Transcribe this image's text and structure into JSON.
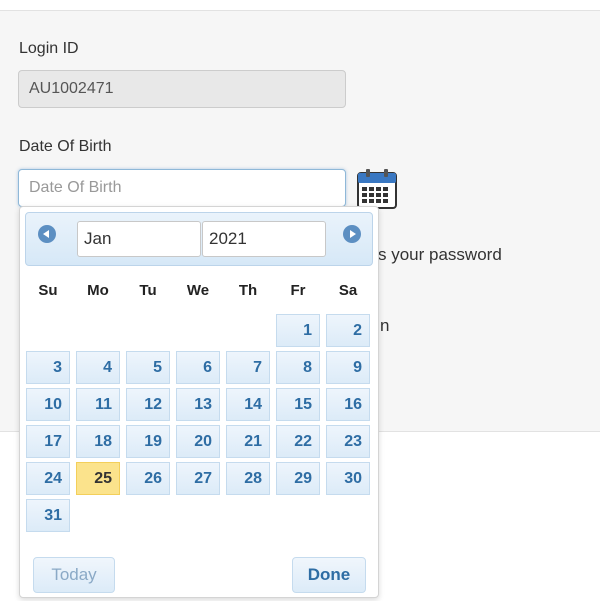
{
  "form": {
    "login_label": "Login ID",
    "login_value": "AU1002471",
    "dob_label": "Date Of Birth",
    "dob_placeholder": "Date Of Birth",
    "dob_value": "",
    "behind_text_1": "s your password",
    "behind_text_2": "n"
  },
  "datepicker": {
    "month": "Jan",
    "year": "2021",
    "weekdays": [
      "Su",
      "Mo",
      "Tu",
      "We",
      "Th",
      "Fr",
      "Sa"
    ],
    "first_weekday_index": 5,
    "days_in_month": 31,
    "highlighted_day": 25,
    "today_label": "Today",
    "done_label": "Done"
  },
  "icons": {
    "calendar": "calendar-icon",
    "prev": "prev-month-icon",
    "next": "next-month-icon"
  },
  "colors": {
    "accent": "#2e6da4",
    "highlight": "#fbe38c"
  }
}
